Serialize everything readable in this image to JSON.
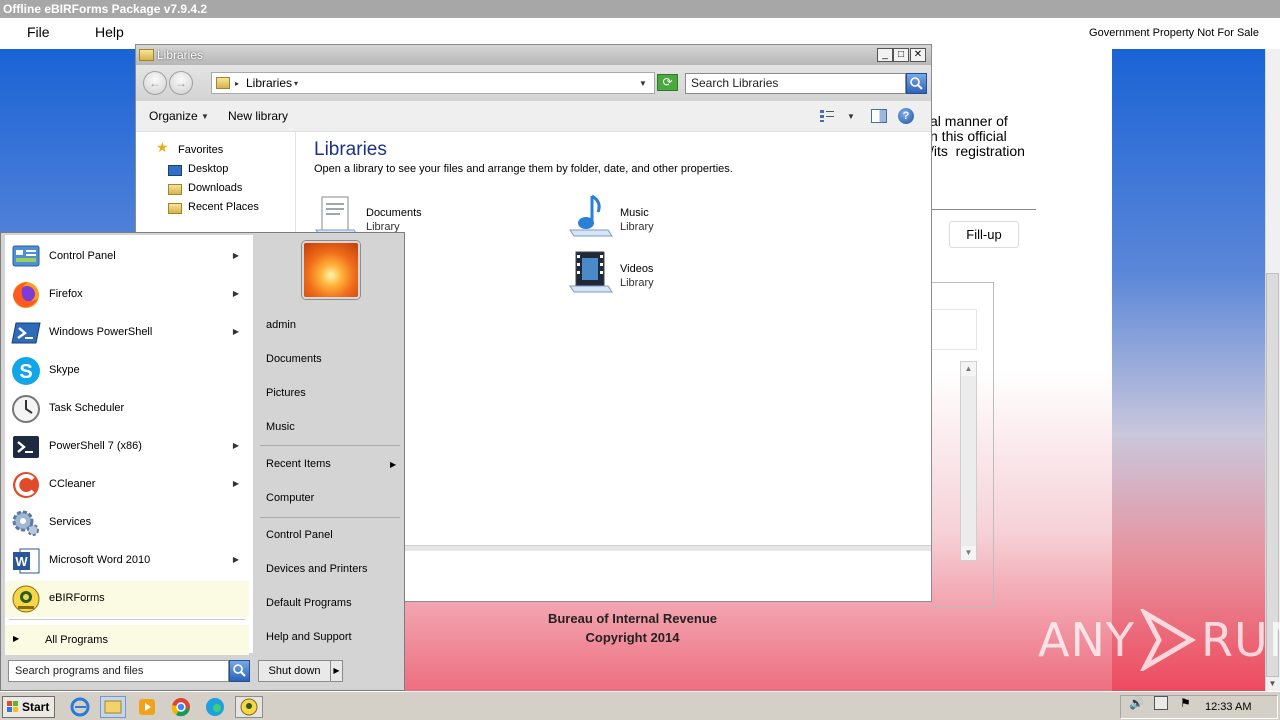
{
  "app": {
    "title": "Offline eBIRForms Package v7.9.4.2",
    "menu": [
      "File",
      "Help"
    ],
    "notice": "Government Property Not For Sale",
    "description": "al manner of\nn this official\n/its  registration",
    "fillup_label": "Fill-up",
    "footer_line1": "Bureau of Internal Revenue",
    "footer_line2": "Copyright 2014",
    "watermark_left": "ANY",
    "watermark_right": "RUN"
  },
  "explorer": {
    "title": "Libraries",
    "address": "Libraries",
    "search_placeholder": "Search Libraries",
    "toolbar": {
      "organize": "Organize",
      "new_library": "New library"
    },
    "nav": {
      "favorites": "Favorites",
      "items": [
        "Desktop",
        "Downloads",
        "Recent Places"
      ]
    },
    "heading": "Libraries",
    "subtitle": "Open a library to see your files and arrange them by folder, date, and other properties.",
    "libraries": [
      {
        "name": "Documents",
        "sub": "Library",
        "icon": "documents-library-icon"
      },
      {
        "name": "Music",
        "sub": "Library",
        "icon": "music-library-icon"
      },
      {
        "name": "Videos",
        "sub": "Library",
        "icon": "videos-library-icon"
      }
    ]
  },
  "start_menu": {
    "programs": [
      {
        "label": "Control Panel",
        "icon": "control-panel-icon",
        "submenu": true
      },
      {
        "label": "Firefox",
        "icon": "firefox-icon",
        "submenu": true
      },
      {
        "label": "Windows PowerShell",
        "icon": "powershell-icon",
        "submenu": true
      },
      {
        "label": "Skype",
        "icon": "skype-icon",
        "submenu": false
      },
      {
        "label": "Task Scheduler",
        "icon": "task-scheduler-icon",
        "submenu": false
      },
      {
        "label": "PowerShell 7 (x86)",
        "icon": "powershell7-icon",
        "submenu": true
      },
      {
        "label": "CCleaner",
        "icon": "ccleaner-icon",
        "submenu": true
      },
      {
        "label": "Services",
        "icon": "services-icon",
        "submenu": false
      },
      {
        "label": "Microsoft Word 2010",
        "icon": "word-icon",
        "submenu": true
      },
      {
        "label": "eBIRForms",
        "icon": "ebirforms-icon",
        "submenu": false
      }
    ],
    "all_programs": "All Programs",
    "search_placeholder": "Search programs and files",
    "right": {
      "user": "admin",
      "documents": "Documents",
      "pictures": "Pictures",
      "music": "Music",
      "recent_items": "Recent Items",
      "computer": "Computer",
      "control_panel": "Control Panel",
      "devices_printers": "Devices and Printers",
      "default_programs": "Default Programs",
      "help_support": "Help and Support"
    },
    "shutdown": "Shut down"
  },
  "taskbar": {
    "start": "Start",
    "clock": "12:33 AM",
    "pinned": [
      "internet-explorer-icon",
      "explorer-icon",
      "media-player-icon",
      "chrome-icon",
      "edge-icon",
      "ebirforms-icon"
    ]
  },
  "colors": {
    "accent_blue": "#1a63d6",
    "accent_red": "#ee4a5e",
    "highlight_yellow": "#fbfbe3",
    "heading_blue": "#1e3287"
  }
}
